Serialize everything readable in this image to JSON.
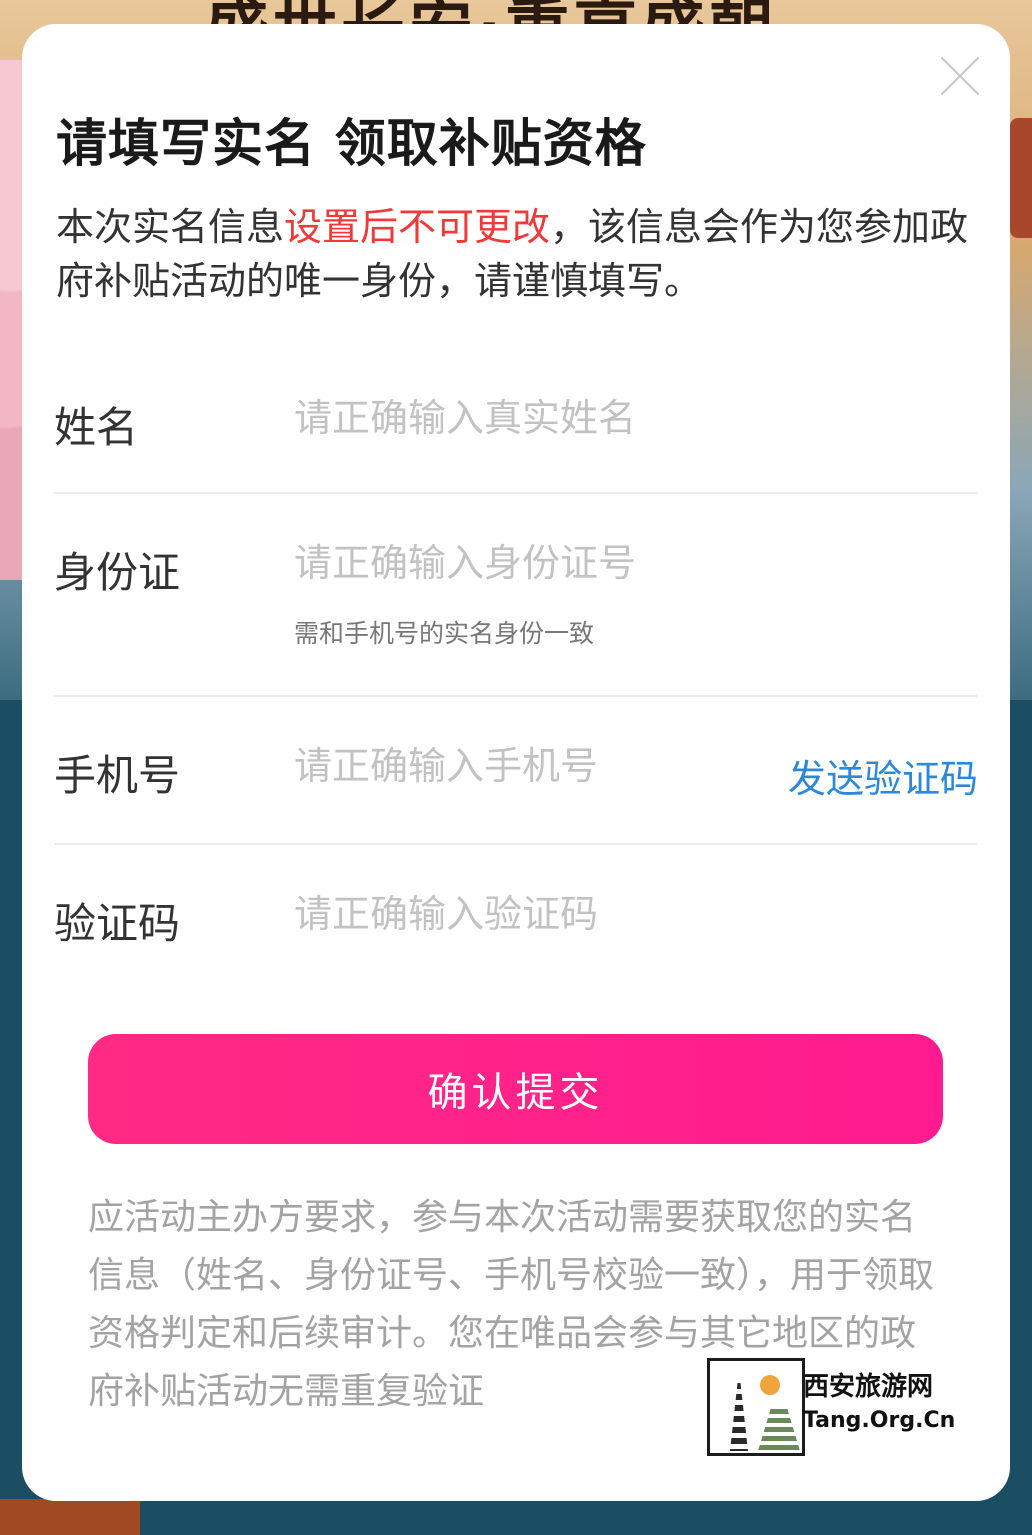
{
  "background": {
    "headline": "盛世长安·重享盛朝"
  },
  "modal": {
    "title": "请填写实名 领取补贴资格",
    "notice": {
      "prefix": "本次实名信息",
      "highlight": "设置后不可更改",
      "suffix": "，该信息会作为您参加政府补贴活动的唯一身份，请谨慎填写。"
    },
    "fields": {
      "name": {
        "label": "姓名",
        "placeholder": "请正确输入真实姓名",
        "value": ""
      },
      "id_card": {
        "label": "身份证",
        "placeholder": "请正确输入身份证号",
        "value": "",
        "hint": "需和手机号的实名身份一致"
      },
      "phone": {
        "label": "手机号",
        "placeholder": "请正确输入手机号",
        "value": "",
        "action": "发送验证码"
      },
      "code": {
        "label": "验证码",
        "placeholder": "请正确输入验证码",
        "value": ""
      }
    },
    "submit_label": "确认提交",
    "disclaimer": "应活动主办方要求，参与本次活动需要获取您的实名信息（姓名、身份证号、手机号校验一致），用于领取资格判定和后续审计。您在唯品会参与其它地区的政府补贴活动无需重复验证"
  },
  "watermark": {
    "name": "西安旅游网",
    "url": "Tang.Org.Cn"
  },
  "colors": {
    "accent": "#ff1b8f",
    "link": "#2b88dd",
    "warning": "#f03a3a"
  }
}
